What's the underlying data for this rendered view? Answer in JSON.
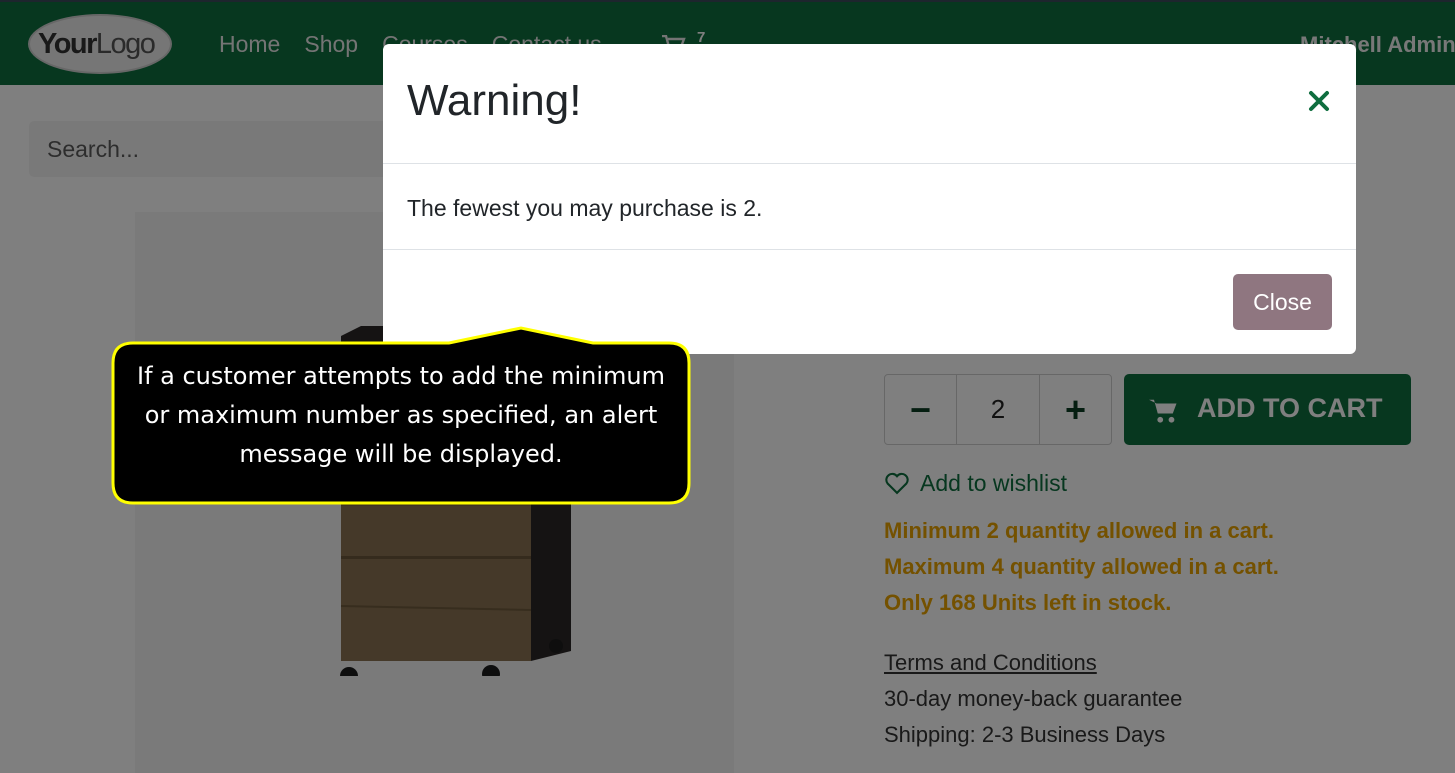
{
  "navbar": {
    "logo_text_bold": "Your",
    "logo_text": "Logo",
    "links": [
      "Home",
      "Shop",
      "Courses",
      "Contact us"
    ],
    "cart_count": "7",
    "user_name": "Mitchell Admin"
  },
  "search": {
    "placeholder": "Search..."
  },
  "product": {
    "quantity": "2",
    "minus_label": "−",
    "plus_label": "+",
    "add_to_cart_label": "ADD TO CART",
    "wishlist_label": "Add to wishlist",
    "messages": [
      "Minimum 2 quantity allowed in a cart.",
      "Maximum 4 quantity allowed in a cart.",
      "Only 168 Units left in stock."
    ],
    "terms_label": "Terms and Conditions",
    "guarantee": "30-day money-back guarantee",
    "shipping": "Shipping: 2-3 Business Days"
  },
  "modal": {
    "title": "Warning!",
    "message": "The fewest you may purchase is 2.",
    "close_label": "Close"
  },
  "callout": {
    "lines": [
      "If a customer attempts to add the minimum",
      "or maximum number as specified, an alert",
      "message will be displayed."
    ]
  },
  "colors": {
    "brand": "#0f6e3f",
    "warning_text": "#e8a300",
    "close_button": "#8f7680",
    "callout_border": "#ffff00"
  },
  "icons": [
    "cart-icon",
    "heart-icon",
    "close-icon",
    "minus-icon",
    "plus-icon"
  ]
}
